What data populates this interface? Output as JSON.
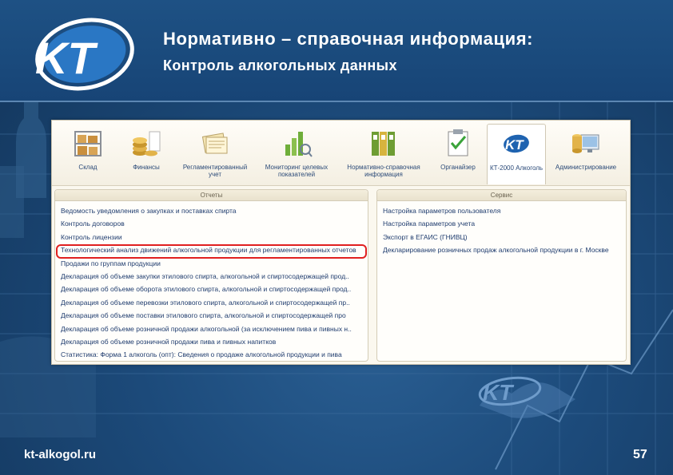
{
  "header": {
    "title": "Нормативно – справочная информация:",
    "subtitle": "Контроль алкогольных данных"
  },
  "logo": {
    "icon": "kt-logo-icon"
  },
  "toolbar": {
    "items": [
      {
        "label": "Склад",
        "icon": "warehouse-icon"
      },
      {
        "label": "Финансы",
        "icon": "coins-icon"
      },
      {
        "label": "Регламентированный учет",
        "icon": "documents-icon"
      },
      {
        "label": "Мониторинг целевых показателей",
        "icon": "chart-icon"
      },
      {
        "label": "Нормативно-справочная информация",
        "icon": "binders-icon"
      },
      {
        "label": "Органайзер",
        "icon": "clipboard-icon"
      },
      {
        "label": "КТ-2000 Алкоголь",
        "icon": "kt-icon"
      },
      {
        "label": "Администрирование",
        "icon": "admin-icon"
      }
    ]
  },
  "reports_panel": {
    "header": "Отчеты",
    "items": [
      "Ведомость уведомления о закупках и поставках спирта",
      "Контроль договоров",
      "Контроль лицензии",
      "Технологический анализ движений алкогольной продукции для регламентированных отчетов",
      "Продажи по группам продукции",
      "Декларация об объеме закупки этилового спирта, алкогольной и спиртосодержащей прод..",
      "Декларация об объеме оборота этилового спирта, алкогольной и спиртосодержащей прод..",
      "Декларация об объеме перевозки этилового спирта, алкогольной и спиртосодержащей пр..",
      "Декларация об объеме поставки этилового спирта, алкогольной и спиртосодержащей про",
      "Декларация об объеме розничной продажи алкогольной (за исключением пива и пивных н..",
      "Декларация об объеме розничной продажи пива и пивных напитков",
      "Статистика: Форма 1 алкоголь (опт): Сведения о продаже алкогольной продукции и пива"
    ]
  },
  "service_panel": {
    "header": "Сервис",
    "items": [
      "Настройка параметров пользователя",
      "Настройка параметров учета",
      "Экспорт в ЕГАИС (ГНИВЦ)",
      "Декларирование розничных продаж алкогольной продукции в г. Москве"
    ]
  },
  "footer": {
    "site": "kt-alkogol.ru",
    "page": "57"
  },
  "colors": {
    "background": "#1c4a7a",
    "highlight": "#e02020",
    "link": "#1f3c6e"
  }
}
